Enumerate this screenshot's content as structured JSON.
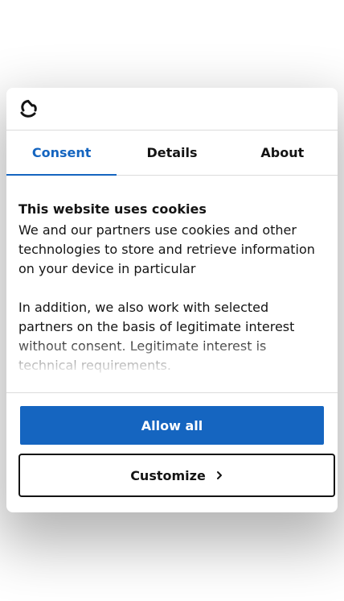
{
  "header": {
    "logo_icon": "cookiebot-logo-icon"
  },
  "tabs": [
    {
      "label": "Consent",
      "active": true
    },
    {
      "label": "Details",
      "active": false
    },
    {
      "label": "About",
      "active": false
    }
  ],
  "content": {
    "title": "This website uses cookies",
    "paragraph1": "We and our partners use cookies and other technologies to store and retrieve information on your device in particular",
    "paragraph2": "In addition, we also work with selected partners on the basis of legitimate interest without consent. Legitimate interest is technical requirements."
  },
  "buttons": {
    "allow_all": "Allow all",
    "customize": "Customize",
    "customize_icon": "chevron-right-icon"
  },
  "colors": {
    "accent": "#1565c0",
    "text": "#141414",
    "divider": "#dcdcdc"
  }
}
